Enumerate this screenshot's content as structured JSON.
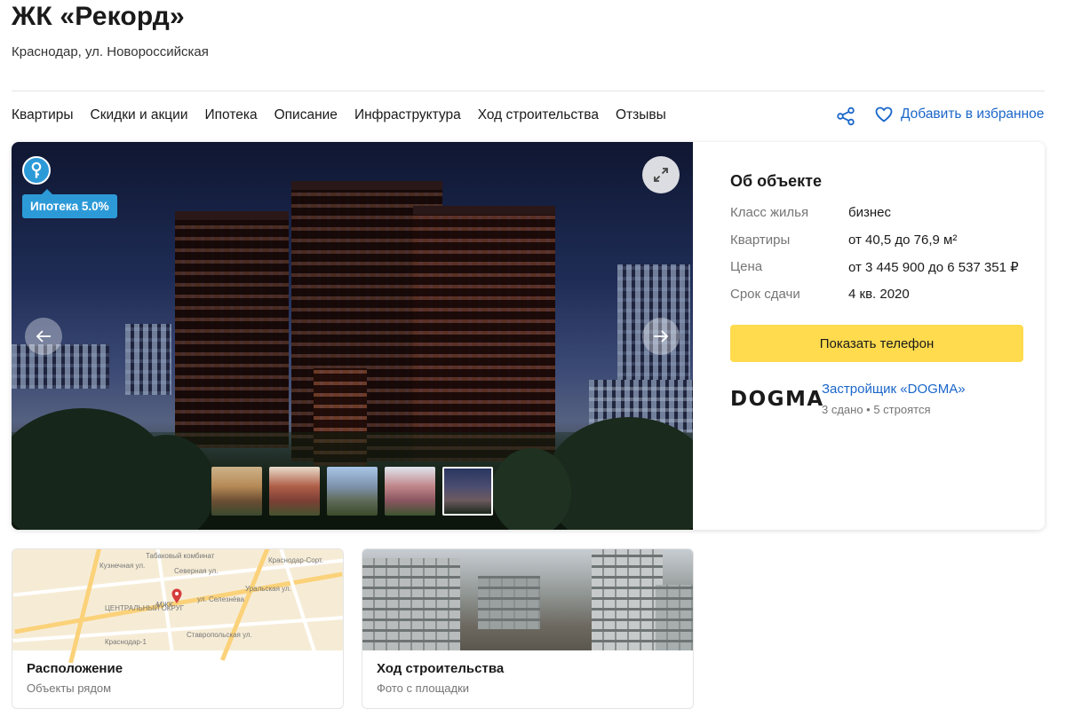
{
  "header": {
    "title": "ЖК «Рекорд»",
    "address": "Краснодар, ул. Новороссийская"
  },
  "nav": {
    "items": [
      "Квартиры",
      "Скидки и акции",
      "Ипотека",
      "Описание",
      "Инфраструктура",
      "Ход строительства",
      "Отзывы"
    ],
    "favorite_label": "Добавить в избранное"
  },
  "gallery": {
    "mortgage_badge": "Ипотека 5.0%",
    "thumbnail_count": 5,
    "active_thumbnail": 5
  },
  "about": {
    "title": "Об объекте",
    "rows": [
      {
        "key": "Класс жилья",
        "value": "бизнес"
      },
      {
        "key": "Квартиры",
        "value": "от 40,5 до 76,9 м²"
      },
      {
        "key": "Цена",
        "value": "от 3 445 900 до 6 537 351 ₽"
      },
      {
        "key": "Срок сдачи",
        "value": "4 кв. 2020"
      }
    ],
    "phone_button": "Показать телефон",
    "developer": {
      "logo": "DOGMA",
      "link": "Застройщик «DOGMA»",
      "stats": "3 сдано • 5 строятся"
    }
  },
  "tiles": {
    "location": {
      "title": "Расположение",
      "subtitle": "Объекты рядом",
      "map_labels": [
        "Табаковый комбинат",
        "Краснодар-Сорт.",
        "Кузнечная ул.",
        "Северная ул.",
        "Уральская ул.",
        "ЦЕНТРАЛЬНЫЙ ОКРУГ",
        "МЖК",
        "ул. Селезнёва",
        "Ставропольская ул.",
        "Краснодар-1"
      ]
    },
    "construction": {
      "title": "Ход строительства",
      "subtitle": "Фото с площадки"
    }
  },
  "colors": {
    "accent_blue": "#2d9ad8",
    "link_blue": "#1a66c9",
    "phone_yellow": "#ffdb4d"
  }
}
